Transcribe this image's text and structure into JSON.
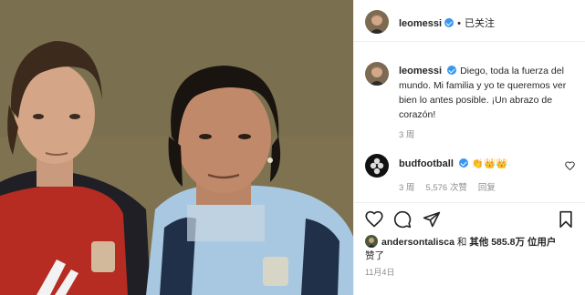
{
  "post": {
    "author": "leomessi",
    "follow_state": "已关注",
    "separator": "•"
  },
  "caption": {
    "username": "leomessi",
    "text": "Diego, toda la fuerza del mundo. Mi familia y yo te queremos ver bien lo antes posible. ¡Un abrazo de corazón!",
    "age": "3 周"
  },
  "comment": {
    "username": "budfootball",
    "emoji": "👏👑👑",
    "age": "3 周",
    "likes": "5,576 次赞",
    "reply": "回复"
  },
  "likes": {
    "user": "andersontalisca",
    "and": "和",
    "others": "其他 585.8万 位用户",
    "suffix": "赞了"
  },
  "date": "11月4日",
  "icons": {
    "like": "heart-icon",
    "comment": "comment-icon",
    "share": "share-icon",
    "save": "bookmark-icon"
  }
}
